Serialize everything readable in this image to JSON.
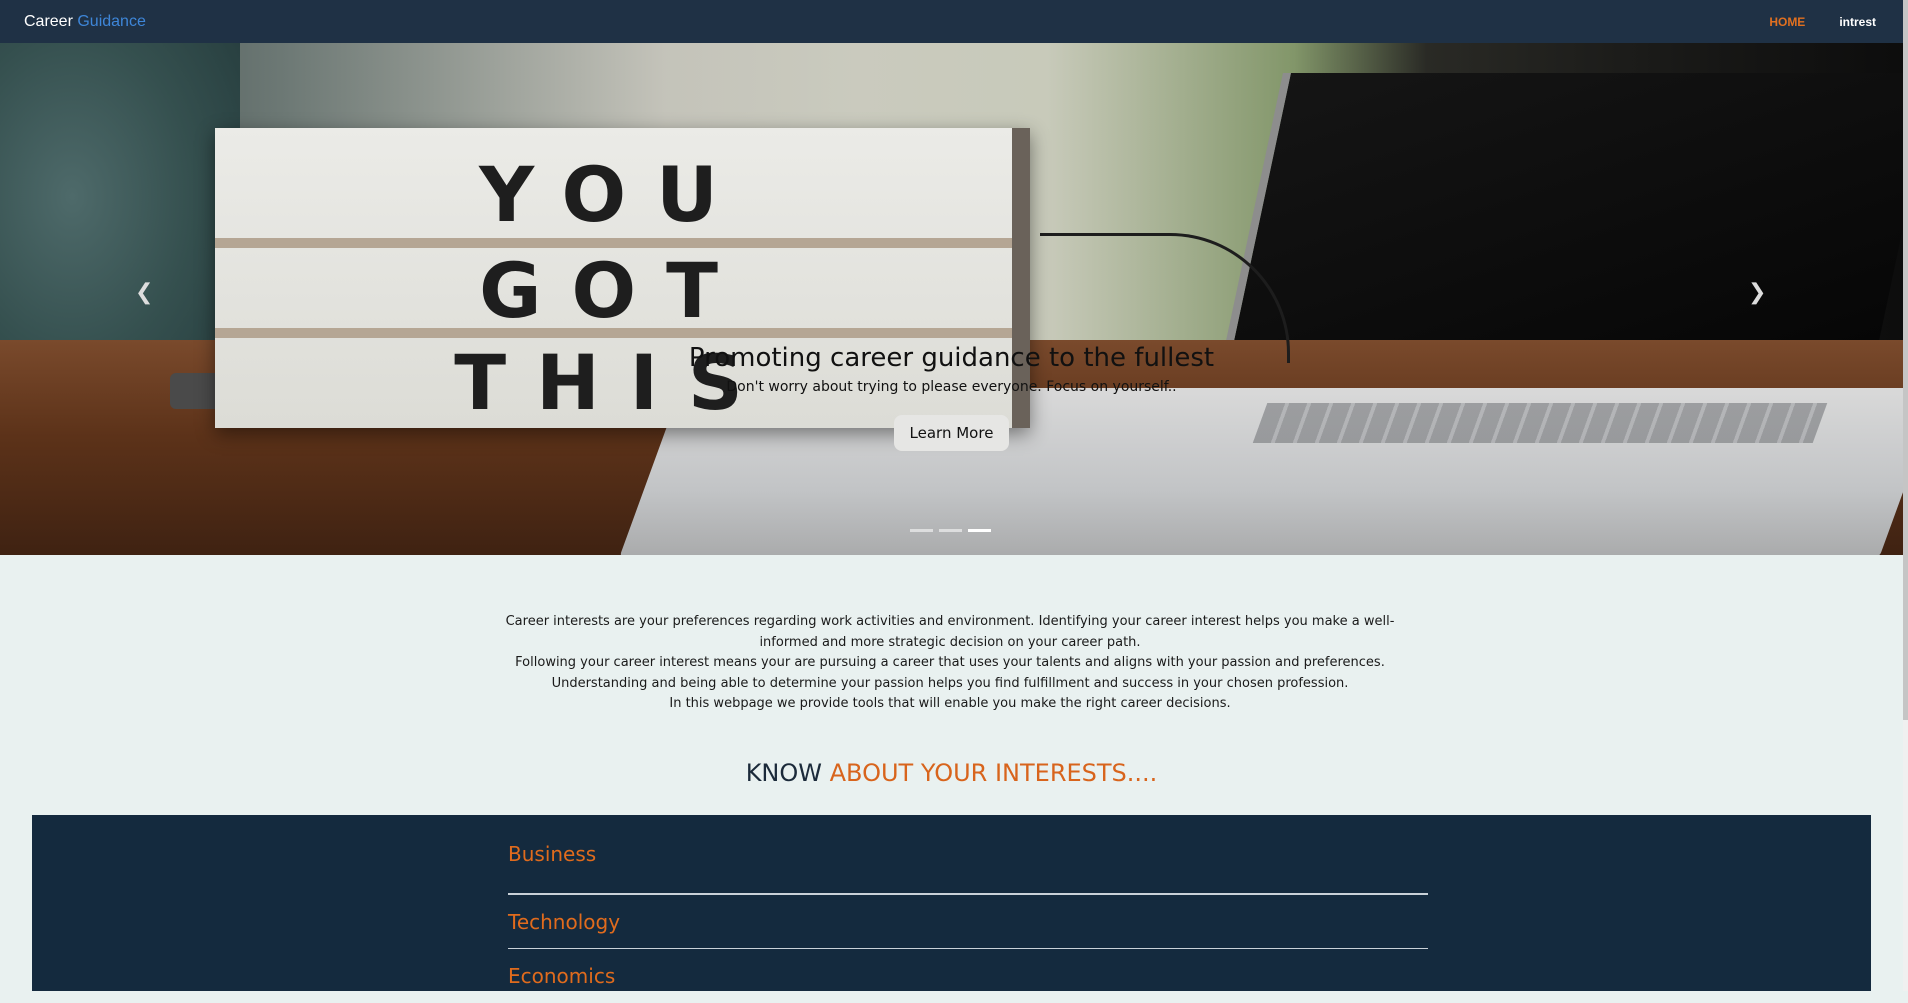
{
  "navbar": {
    "brand_main": "Career",
    "brand_accent": "Guidance",
    "links": [
      {
        "label": "HOME",
        "active": true
      },
      {
        "label": "intrest",
        "active": false
      }
    ]
  },
  "carousel": {
    "image_text": [
      "YOU",
      "GOT",
      "THIS"
    ],
    "caption_title": "Promoting career guidance to the fullest",
    "caption_text": "Don't worry about trying to please everyone. Focus on yourself..",
    "button_label": "Learn More",
    "prev_icon": "chevron-left-icon",
    "next_icon": "chevron-right-icon",
    "slides_count": 3,
    "active_slide": 3
  },
  "intro": {
    "paragraphs": [
      "Career interests are your preferences regarding work activities and environment. Identifying your career interest helps you make a well-informed and more strategic decision on your career path.",
      "Following your career interest means your are pursuing a career that uses your talents and aligns with your passion and preferences. Understanding and being able to determine your passion helps you find fulfillment and success in your chosen profession.",
      "In this webpage we provide tools that will enable you make the right career decisions."
    ]
  },
  "know_heading": {
    "prefix": "KNOW",
    "accent": "ABOUT YOUR INTERESTS...."
  },
  "interests": [
    "Business",
    "Technology",
    "Economics"
  ],
  "colors": {
    "navbar_bg": "#1f3145",
    "accent_orange": "#e06b1d",
    "brand_blue": "#3e86d8",
    "panel_bg": "#142a3e"
  }
}
